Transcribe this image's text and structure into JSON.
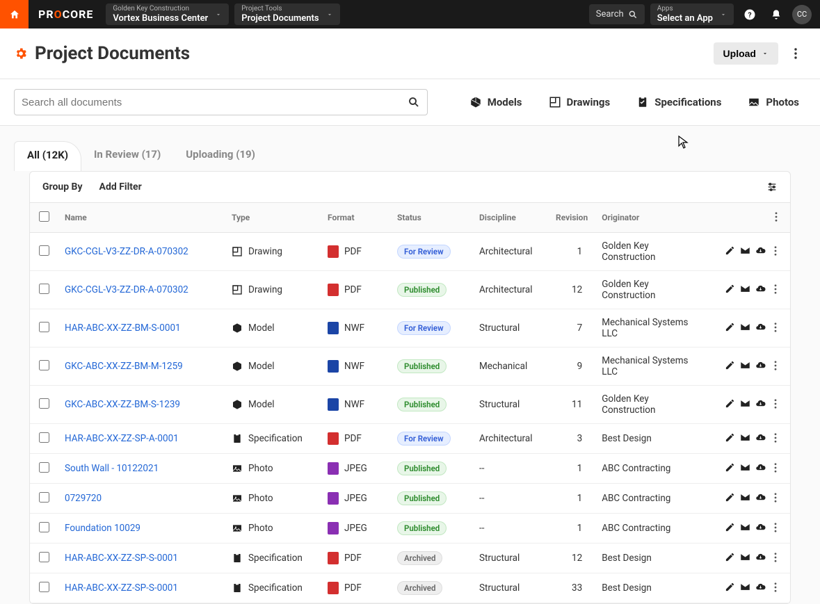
{
  "topbar": {
    "brand_pre": "PR",
    "brand_o": "O",
    "brand_post": "CORE",
    "project_label": "Golden Key Construction",
    "project_value": "Vortex Business Center",
    "tool_label": "Project Tools",
    "tool_value": "Project Documents",
    "search_label": "Search",
    "apps_label": "Apps",
    "apps_value": "Select an App",
    "avatar_initials": "CC"
  },
  "header": {
    "title": "Project Documents",
    "upload_label": "Upload"
  },
  "search": {
    "placeholder": "Search all documents"
  },
  "quicklinks": {
    "models": "Models",
    "drawings": "Drawings",
    "specifications": "Specifications",
    "photos": "Photos"
  },
  "tabs": {
    "all": "All (12K)",
    "in_review": "In Review (17)",
    "uploading": "Uploading (19)"
  },
  "panel": {
    "group_by": "Group By",
    "add_filter": "Add Filter"
  },
  "columns": {
    "name": "Name",
    "type": "Type",
    "format": "Format",
    "status": "Status",
    "discipline": "Discipline",
    "revision": "Revision",
    "originator": "Originator"
  },
  "type_icons": {
    "Drawing": "drawing",
    "Model": "model",
    "Specification": "specification",
    "Photo": "photo"
  },
  "rows": [
    {
      "name": "GKC-CGL-V3-ZZ-DR-A-070302",
      "type": "Drawing",
      "format": "PDF",
      "status": "For Review",
      "discipline": "Architectural",
      "revision": "1",
      "originator": "Golden Key Construction"
    },
    {
      "name": "GKC-CGL-V3-ZZ-DR-A-070302",
      "type": "Drawing",
      "format": "PDF",
      "status": "Published",
      "discipline": "Architectural",
      "revision": "12",
      "originator": "Golden Key Construction"
    },
    {
      "name": "HAR-ABC-XX-ZZ-BM-S-0001",
      "type": "Model",
      "format": "NWF",
      "status": "For Review",
      "discipline": "Structural",
      "revision": "7",
      "originator": "Mechanical Systems LLC"
    },
    {
      "name": "GKC-ABC-XX-ZZ-BM-M-1259",
      "type": "Model",
      "format": "NWF",
      "status": "Published",
      "discipline": "Mechanical",
      "revision": "9",
      "originator": "Mechanical Systems LLC"
    },
    {
      "name": "GKC-ABC-XX-ZZ-BM-S-1239",
      "type": "Model",
      "format": "NWF",
      "status": "Published",
      "discipline": "Structural",
      "revision": "11",
      "originator": "Golden Key Construction"
    },
    {
      "name": "HAR-ABC-XX-ZZ-SP-A-0001",
      "type": "Specification",
      "format": "PDF",
      "status": "For Review",
      "discipline": "Architectural",
      "revision": "3",
      "originator": "Best Design"
    },
    {
      "name": "South Wall - 10122021",
      "type": "Photo",
      "format": "JPEG",
      "status": "Published",
      "discipline": "--",
      "revision": "1",
      "originator": "ABC Contracting"
    },
    {
      "name": "0729720",
      "type": "Photo",
      "format": "JPEG",
      "status": "Published",
      "discipline": "--",
      "revision": "1",
      "originator": "ABC Contracting"
    },
    {
      "name": "Foundation 10029",
      "type": "Photo",
      "format": "JPEG",
      "status": "Published",
      "discipline": "--",
      "revision": "1",
      "originator": "ABC Contracting"
    },
    {
      "name": "HAR-ABC-XX-ZZ-SP-S-0001",
      "type": "Specification",
      "format": "PDF",
      "status": "Archived",
      "discipline": "Structural",
      "revision": "12",
      "originator": "Best Design"
    },
    {
      "name": "HAR-ABC-XX-ZZ-SP-S-0001",
      "type": "Specification",
      "format": "PDF",
      "status": "Archived",
      "discipline": "Structural",
      "revision": "33",
      "originator": "Best Design"
    }
  ]
}
